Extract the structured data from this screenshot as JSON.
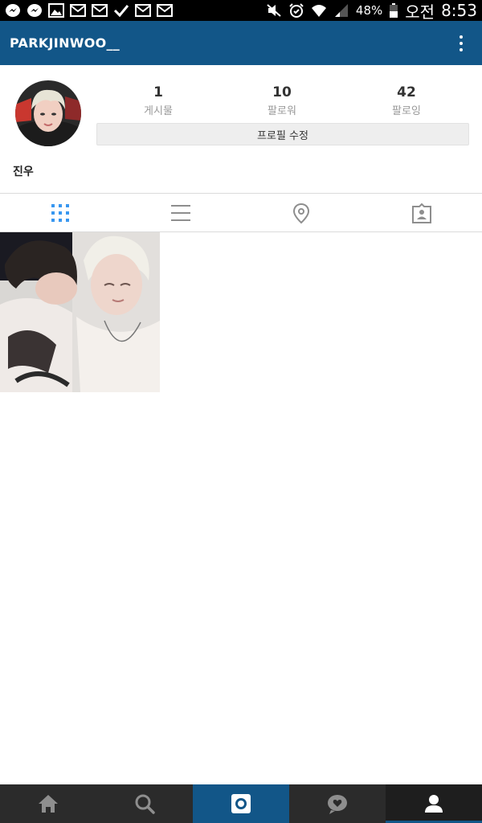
{
  "status_bar": {
    "battery_percent": "48%",
    "am_pm": "오전",
    "time": "8:53",
    "left_icons": [
      "messenger-icon",
      "messenger-icon",
      "gallery-icon",
      "mail-icon",
      "mail-icon",
      "check-icon",
      "mail-icon",
      "mail-icon"
    ],
    "right_icons": [
      "mute-icon",
      "alarm-icon",
      "wifi-icon",
      "signal-icon",
      "battery-icon"
    ]
  },
  "header": {
    "username": "PARKJINWOO__",
    "menu_icon": "overflow-menu-icon"
  },
  "profile": {
    "stats": [
      {
        "count": "1",
        "label": "게시물"
      },
      {
        "count": "10",
        "label": "팔로워"
      },
      {
        "count": "42",
        "label": "팔로잉"
      }
    ],
    "edit_button_label": "프로필 수정",
    "display_name": "진우"
  },
  "tabs": [
    {
      "icon": "grid-icon",
      "active": true
    },
    {
      "icon": "list-icon",
      "active": false
    },
    {
      "icon": "location-pin-icon",
      "active": false
    },
    {
      "icon": "tagged-photos-icon",
      "active": false
    }
  ],
  "posts_count_shown": 1,
  "bottom_nav": [
    {
      "icon": "home-icon"
    },
    {
      "icon": "search-icon"
    },
    {
      "icon": "camera-icon"
    },
    {
      "icon": "activity-heart-icon"
    },
    {
      "icon": "profile-icon",
      "active": true
    }
  ],
  "colors": {
    "brand": "#125688",
    "status_bar": "#000000",
    "bottom_nav": "#2b2b2b",
    "active_tab_icon": "#3897f0",
    "inactive_icon": "#8e8e8e"
  }
}
